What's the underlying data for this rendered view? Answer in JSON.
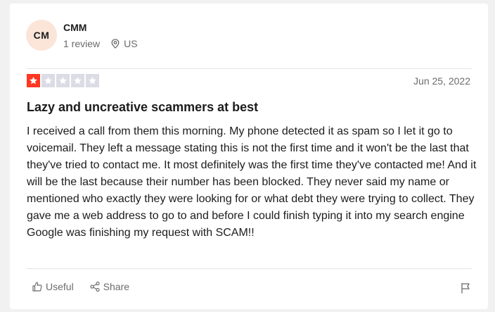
{
  "review": {
    "avatar_initials": "CM",
    "user_name": "CMM",
    "review_count": "1 review",
    "location": "US",
    "rating": 1,
    "rating_max": 5,
    "star_filled_color": "#ff3722",
    "star_empty_color": "#dcdce6",
    "date": "Jun 25, 2022",
    "title": "Lazy and uncreative scammers at best",
    "body": "I received a call from them this morning. My phone detected it as spam so I let it go to voicemail. They left a message stating this is not the first time and it won't be the last that they've tried to contact me. It most definitely was the first time they've contacted me! And it will be the last because their number has been blocked. They never said my name or mentioned who exactly they were looking for or what debt they were trying to collect. They gave me a web address to go to and before I could finish typing it into my search engine Google was finishing my request with SCAM!!"
  },
  "actions": {
    "useful_label": "Useful",
    "share_label": "Share"
  },
  "icons": {
    "location": "location-pin-icon",
    "useful": "thumbs-up-icon",
    "share": "share-icon",
    "flag": "flag-icon"
  }
}
